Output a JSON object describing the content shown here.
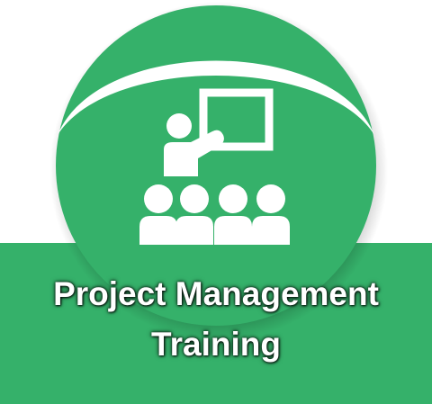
{
  "badge": {
    "title_line1": "Project Management",
    "title_line2": "Training",
    "icon": "presentation-training-icon"
  },
  "colors": {
    "green": "#35b16a",
    "green_dark": "#2a9457",
    "text": "#ffffff",
    "background": "#ffffff"
  }
}
